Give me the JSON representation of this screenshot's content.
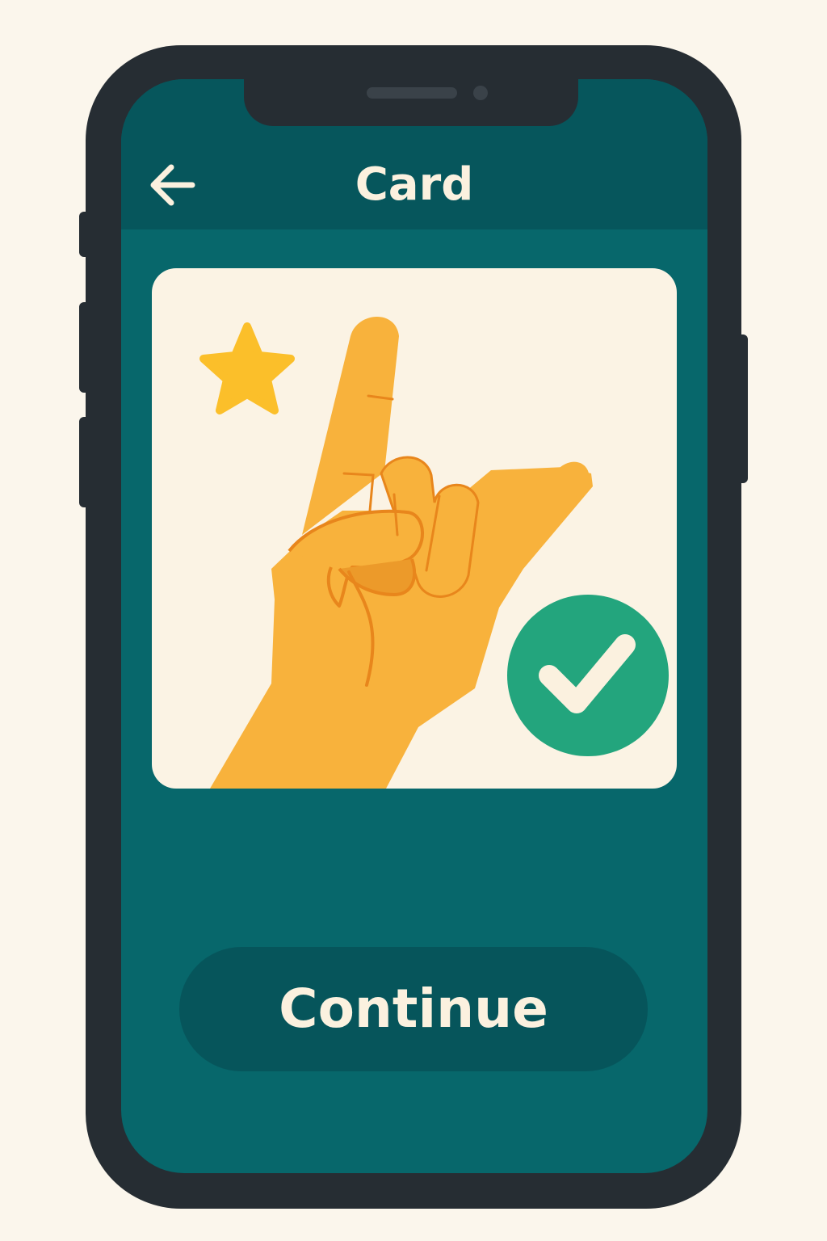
{
  "header": {
    "title": "Card",
    "back_icon": "arrow-left-icon"
  },
  "card": {
    "illustration": "hand-sign-icon",
    "decoration_icon": "star-icon",
    "status_icon": "check-circle-icon",
    "colors": {
      "card_background": "#fbf3e4",
      "hand": "#f8b23c",
      "hand_outline": "#e8861c",
      "star": "#fbbf2a",
      "check_badge": "#23a57d",
      "check_mark": "#fbf1df"
    }
  },
  "actions": {
    "continue_label": "Continue"
  },
  "theme": {
    "page_background": "#fbf6ec",
    "screen_background": "#07676b",
    "header_background": "#06565c",
    "button_background": "#06555b",
    "text_light": "#fbf1df",
    "device_frame": "#262d33"
  }
}
